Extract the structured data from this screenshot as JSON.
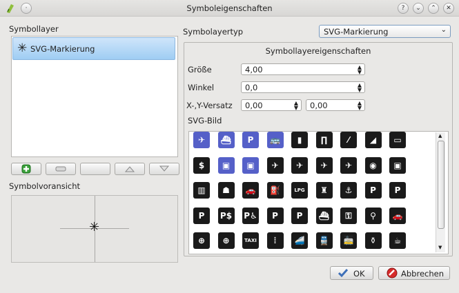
{
  "window": {
    "title": "Symboleigenschaften"
  },
  "left": {
    "layers_heading": "Symbollayer",
    "layers": [
      {
        "label": "SVG-Markierung",
        "icon": "asterisk-icon",
        "selected": true
      }
    ],
    "buttons": [
      "add-icon",
      "remove-icon",
      "lock-icon",
      "move-up-icon",
      "move-down-icon"
    ],
    "preview_heading": "Symbolvoransicht"
  },
  "right": {
    "type_label": "Symbolayertyp",
    "type_value": "SVG-Markierung",
    "group_title": "Symbollayereigenschaften",
    "fields": {
      "size_label": "Größe",
      "size_value": "4,00",
      "angle_label": "Winkel",
      "angle_value": "0,0",
      "offset_label": "X-,Y-Versatz",
      "offset_x": "0,00",
      "offset_y": "0,00"
    },
    "svg_label": "SVG-Bild",
    "svg_icons": [
      [
        "airplane-icon",
        "ferry-icon",
        "parking-icon",
        "bus-icon",
        "tomb-icon",
        "gate-icon",
        "no-entry-icon",
        "barrier-icon",
        "bridge-icon"
      ],
      [
        "ticket-machine-icon",
        "tram-icon",
        "train-icon",
        "airport-icon",
        "airplane-icon",
        "airplane-icon",
        "airplane-icon",
        "subway-icon",
        "bus-icon"
      ],
      [
        "bus-stop-icon",
        "taxi-rank-icon",
        "car-icon",
        "fuel-icon",
        "lpg-icon",
        "lighthouse-icon",
        "anchor-icon",
        "parking-icon",
        "bicycle-parking-icon"
      ],
      [
        "parking-car-icon",
        "paid-parking-icon",
        "disabled-parking-icon",
        "parking-grey-icon",
        "parking-dark-icon",
        "ship-icon",
        "car-key-icon",
        "bicycle-rental-icon",
        "car-rental-icon"
      ],
      [
        "roundabout-icon",
        "roundabout-icon",
        "taxi-icon",
        "traffic-light-icon",
        "train-icon",
        "train-front-icon",
        "tram-icon",
        "vase-icon",
        "shoe-icon"
      ]
    ],
    "svg_icon_glyphs": [
      [
        "✈",
        "⛴",
        "P",
        "🚌",
        "▮",
        "∏",
        "⁄",
        "◢",
        "▭"
      ],
      [
        "$",
        "▣",
        "▣",
        "✈",
        "✈",
        "✈",
        "✈",
        "◉",
        "▣"
      ],
      [
        "▥",
        "☗",
        "🚗",
        "⛽",
        "LPG",
        "♜",
        "⚓",
        "P",
        "P"
      ],
      [
        "P",
        "P$",
        "P♿",
        "P",
        "P",
        "⛴",
        "⚿",
        "⚲",
        "🚗"
      ],
      [
        "⊕",
        "⊕",
        "TAXI",
        "⦙",
        "🚄",
        "🚆",
        "🚋",
        "⚱",
        "☕"
      ]
    ],
    "icon_colors": {
      "dark": "#1a1a1a",
      "blue": "#5560c8"
    }
  },
  "dialog": {
    "ok_label": "OK",
    "cancel_label": "Abbrechen"
  }
}
